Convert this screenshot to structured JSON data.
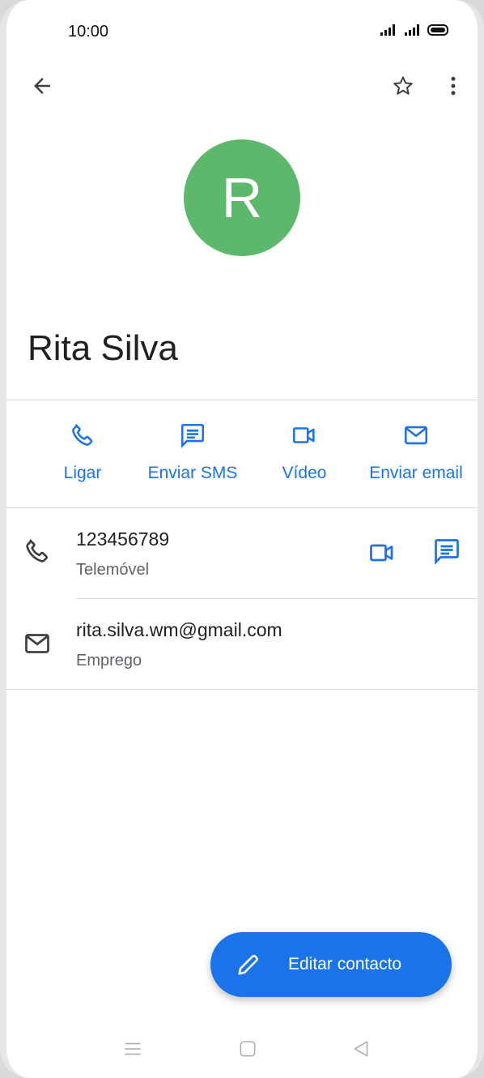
{
  "status_bar": {
    "time": "10:00"
  },
  "contact": {
    "initial": "R",
    "name": "Rita Silva",
    "avatar_color": "#5cb86b"
  },
  "actions": [
    {
      "label": "Ligar",
      "icon": "phone-icon"
    },
    {
      "label": "Enviar SMS",
      "icon": "message-icon"
    },
    {
      "label": "Vídeo",
      "icon": "video-icon"
    },
    {
      "label": "Enviar email",
      "icon": "email-icon"
    }
  ],
  "details": {
    "phone": {
      "value": "123456789",
      "type": "Telemóvel"
    },
    "email": {
      "value": "rita.silva.wm@gmail.com",
      "type": "Emprego"
    }
  },
  "fab": {
    "label": "Editar contacto",
    "icon": "edit-icon"
  },
  "colors": {
    "accent": "#1a73e8",
    "divider": "#dadce0",
    "text_primary": "#202124",
    "text_secondary": "#5f6368"
  }
}
